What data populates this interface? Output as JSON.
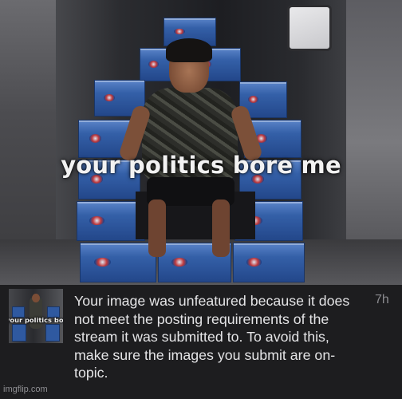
{
  "meme": {
    "caption": "your politics bore me",
    "scene": "kid-on-throne-of-boxes"
  },
  "notification": {
    "thumbnail_caption": "your politics bore me",
    "message": "Your image was unfeatured because it does not meet the posting requirements of the stream it was submitted to. To avoid this, make sure the images you submit are on-topic.",
    "time": "7h"
  },
  "watermark": "imgflip.com",
  "colors": {
    "panel_background": "#1d1d1f",
    "message_text": "#e4e4e6",
    "time_text": "#8a8a8e",
    "caption_text": "#f2f2f2",
    "box_blue": "#2f59a0"
  }
}
